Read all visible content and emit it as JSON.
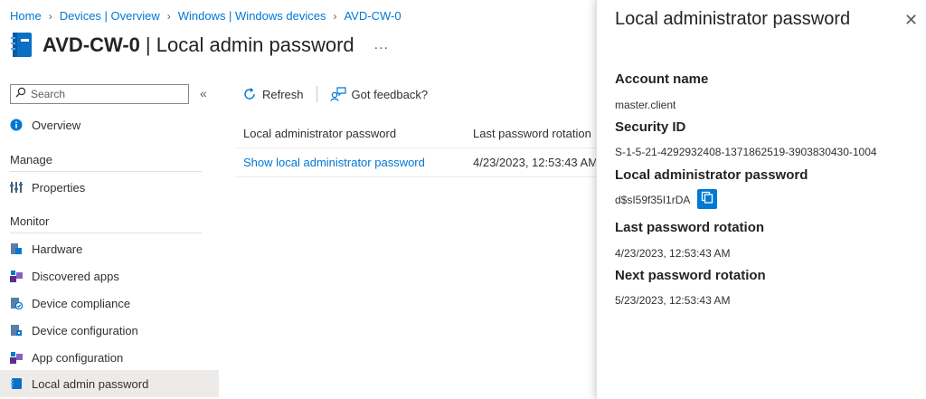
{
  "breadcrumb": [
    "Home",
    "Devices | Overview",
    "Windows | Windows devices",
    "AVD-CW-0"
  ],
  "header": {
    "device": "AVD-CW-0",
    "subtitle": "| Local admin password",
    "more": "..."
  },
  "search": {
    "placeholder": "Search"
  },
  "collapse": "«",
  "nav": {
    "overview": "Overview",
    "manage_heading": "Manage",
    "properties": "Properties",
    "monitor_heading": "Monitor",
    "monitor_items": [
      "Hardware",
      "Discovered apps",
      "Device compliance",
      "Device configuration",
      "App configuration",
      "Local admin password"
    ]
  },
  "toolbar": {
    "refresh": "Refresh",
    "feedback": "Got feedback?"
  },
  "table": {
    "columns": [
      "Local administrator password",
      "Last password rotation"
    ],
    "rows": [
      {
        "link": "Show local administrator password",
        "rotation": "4/23/2023, 12:53:43 AM"
      }
    ]
  },
  "pane": {
    "title": "Local administrator password",
    "close": "✕",
    "account_label": "Account name",
    "account_value": "master.client",
    "sid_label": "Security ID",
    "sid_value": "S-1-5-21-4292932408-1371862519-3903830430-1004",
    "password_label": "Local administrator password",
    "password_value": "d$sI59f35I1rDA",
    "last_label": "Last password rotation",
    "last_value": "4/23/2023, 12:53:43 AM",
    "next_label": "Next password rotation",
    "next_value": "5/23/2023, 12:53:43 AM"
  },
  "colors": {
    "accent": "#0078d4",
    "selected_bg": "#edebe9",
    "text": "#323130"
  },
  "icons": [
    "notebook-icon",
    "search-icon",
    "info-icon",
    "properties-icon",
    "hardware-icon",
    "apps-icon",
    "compliance-icon",
    "configuration-icon",
    "refresh-icon",
    "feedback-icon",
    "copy-icon",
    "close-icon"
  ]
}
